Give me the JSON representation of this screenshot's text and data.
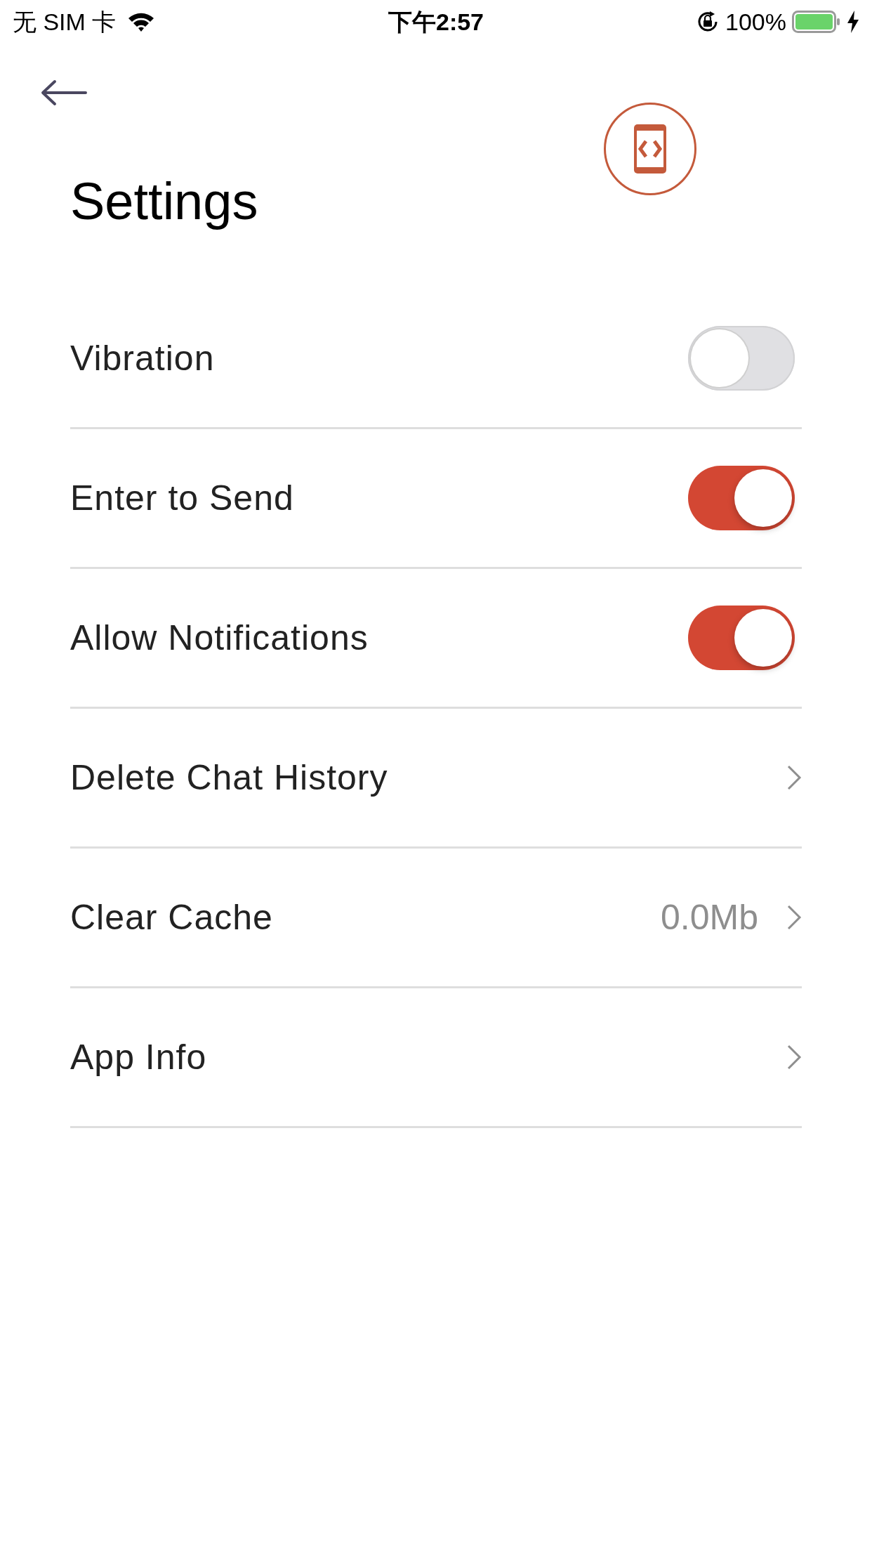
{
  "status_bar": {
    "carrier": "无 SIM 卡",
    "time": "下午2:57",
    "battery": "100%"
  },
  "header": {
    "title": "Settings"
  },
  "items": [
    {
      "kind": "toggle",
      "label": "Vibration",
      "on": false
    },
    {
      "kind": "toggle",
      "label": "Enter to Send",
      "on": true
    },
    {
      "kind": "toggle",
      "label": "Allow Notifications",
      "on": true
    },
    {
      "kind": "link",
      "label": "Delete Chat History"
    },
    {
      "kind": "link",
      "label": "Clear Cache",
      "value": "0.0Mb"
    },
    {
      "kind": "link",
      "label": "App Info"
    }
  ]
}
